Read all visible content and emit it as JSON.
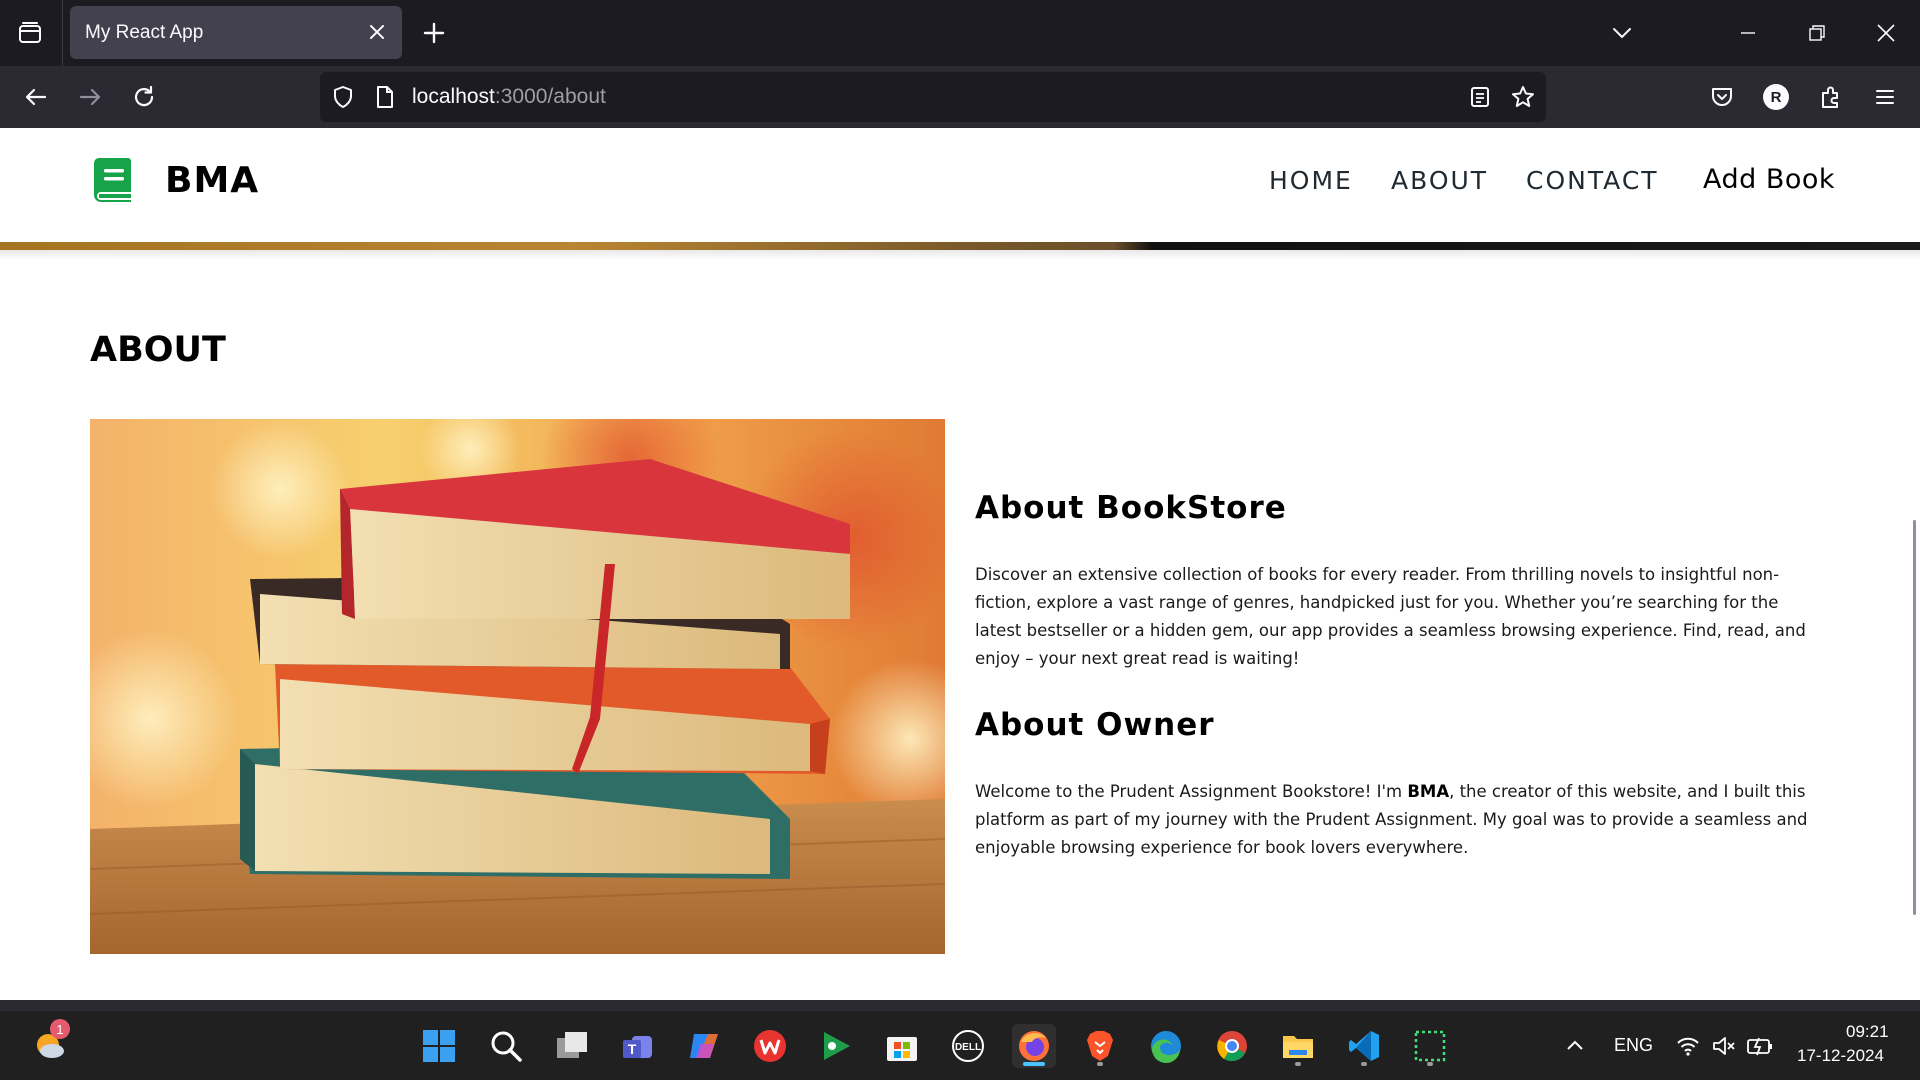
{
  "browser": {
    "tab_title": "My React App",
    "url_host": "localhost",
    "url_path": ":3000/about",
    "profile_initial": "R"
  },
  "site": {
    "brand": "BMA",
    "nav": [
      "HOME",
      "ABOUT",
      "CONTACT",
      "Add Book"
    ],
    "page_title": "ABOUT",
    "about_bookstore": {
      "title": "About BookStore",
      "text": "Discover an extensive collection of books for every reader. From thrilling novels to insightful non-fiction, explore a vast range of genres, handpicked just for you. Whether you’re searching for the latest bestseller or a hidden gem, our app provides a seamless browsing experience. Find, read, and enjoy – your next great read is waiting!"
    },
    "about_owner": {
      "title": "About Owner",
      "text_before": "Welcome to the Prudent Assignment Bookstore! I'm ",
      "name": "BMA",
      "text_after": ", the creator of this website, and I built this platform as part of my journey with the Prudent Assignment. My goal was to provide a seamless and enjoyable browsing experience for book lovers everywhere."
    }
  },
  "taskbar": {
    "weather_badge": "1",
    "language": "ENG",
    "time": "09:21",
    "date": "17-12-2024",
    "apps": [
      "start-icon",
      "search-icon",
      "task-view-icon",
      "teams-icon",
      "copilot-icon",
      "wps-office-icon",
      "game-pass-icon",
      "microsoft-store-icon",
      "dell-icon",
      "firefox-icon",
      "brave-icon",
      "edge-icon",
      "chrome-icon",
      "file-explorer-icon",
      "vscode-icon",
      "snipping-tool-icon"
    ]
  },
  "colors": {
    "chrome_dark": "#1c1b22",
    "chrome_toolbar": "#2b2a33",
    "tab_active": "#42414d",
    "brand_green": "#16a34a",
    "taskbar": "#202020"
  }
}
